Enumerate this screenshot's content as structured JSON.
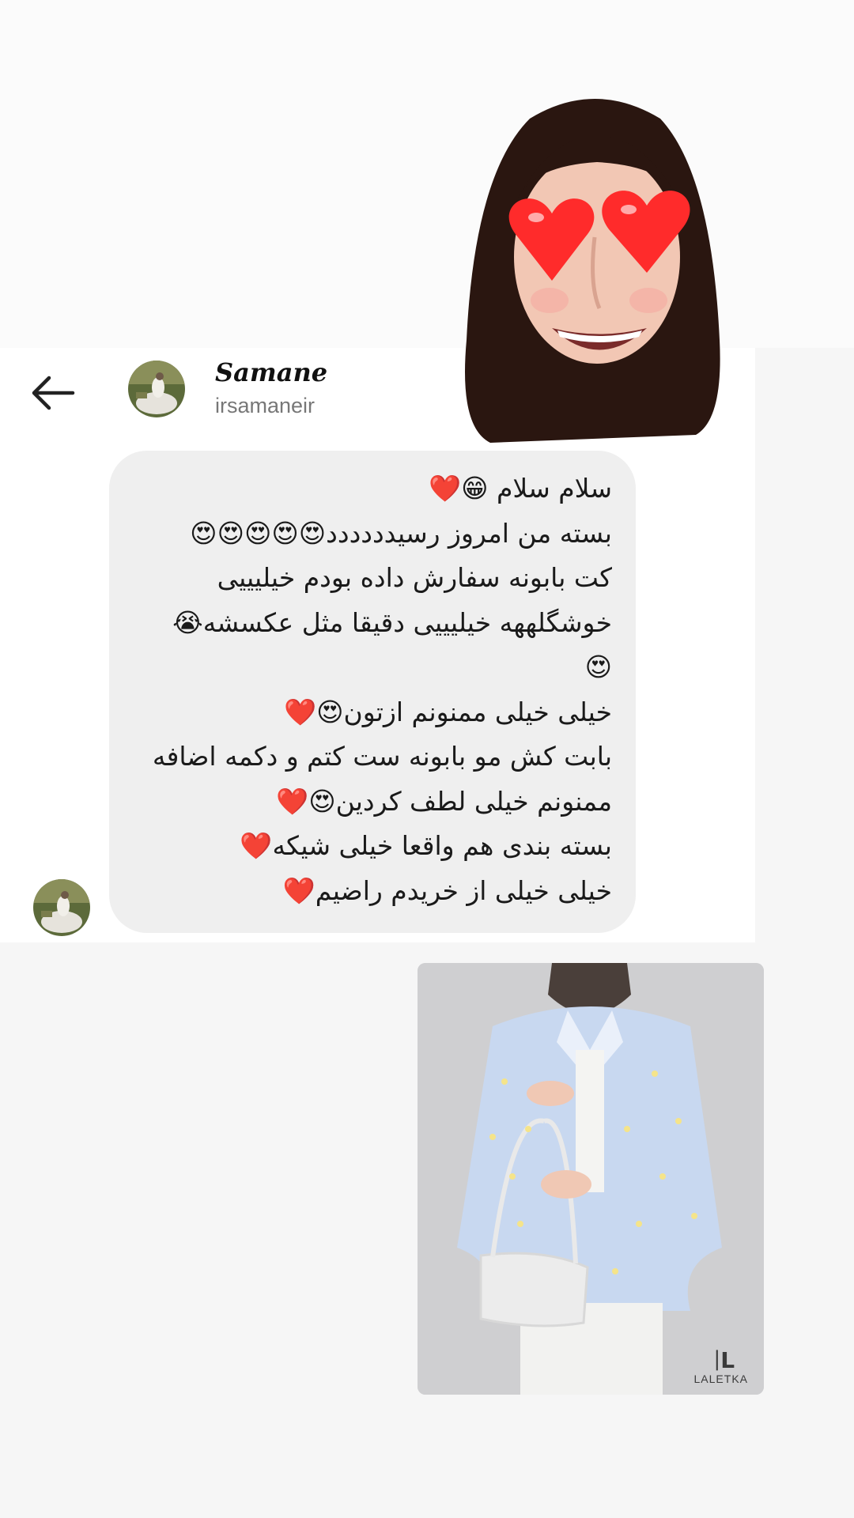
{
  "header": {
    "name": "Samane",
    "username": "irsamaneir"
  },
  "message": {
    "lines": [
      "سلام سلام 😁❤️",
      "بسته من امروز رسیدددددد😍😍😍😍😍",
      "کت بابونه سفارش داده بودم خیلیییی",
      "خوشگلههه خیلیییی دقیقا مثل عکسشه😭",
      "😍",
      "خیلی خیلی ممنونم ازتون😍❤️",
      "بابت کش مو بابونه ست کتم و دکمه اضافه",
      "ممنونم خیلی لطف کردین😍❤️",
      "بسته بندی هم واقعا خیلی شیکه❤️",
      "خیلی خیلی از خریدم راضیم❤️"
    ]
  },
  "product": {
    "brand_mark": "ᛁL",
    "brand_name": "LALETKA"
  },
  "icons": {
    "back": "arrow-left-icon",
    "memoji": "heart-eyes-memoji-sticker"
  },
  "colors": {
    "page_background": "#f6f6f6",
    "card_background": "#ffffff",
    "bubble_background": "#efefef",
    "heart_red": "#e8202e"
  }
}
